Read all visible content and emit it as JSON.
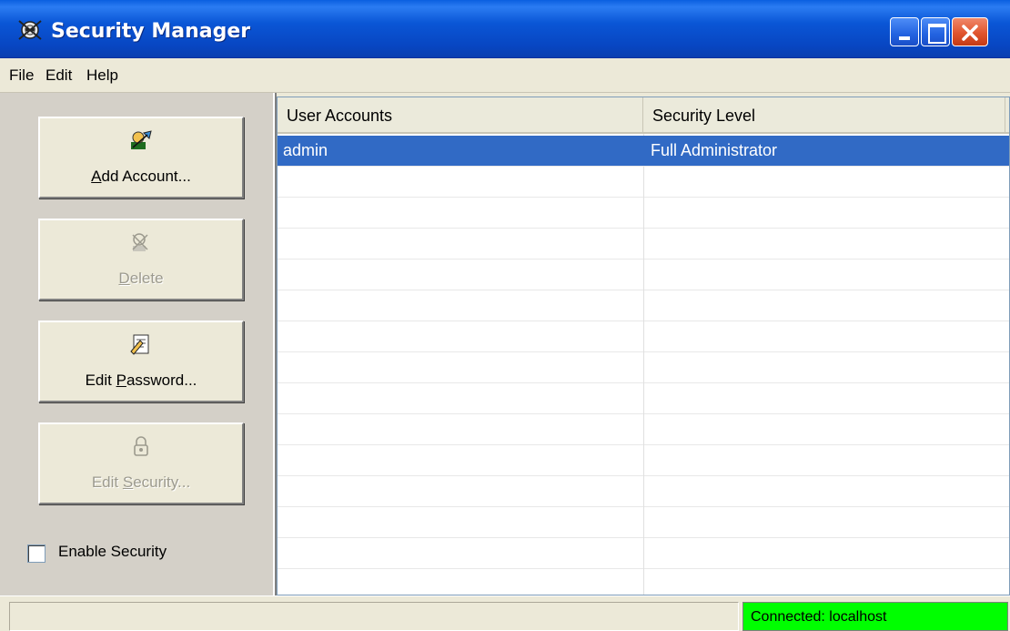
{
  "window": {
    "title": "Security Manager"
  },
  "menu": [
    {
      "label": "File"
    },
    {
      "label": "Edit"
    },
    {
      "label": "Help"
    }
  ],
  "commands": {
    "add_account": {
      "mnemonic": "A",
      "rest": "dd Account...",
      "enabled": true,
      "icon": "user-add-icon"
    },
    "delete": {
      "mnemonic": "D",
      "rest": "elete",
      "enabled": false,
      "icon": "user-delete-icon"
    },
    "edit_password": {
      "prefix": "Edit ",
      "mnemonic": "P",
      "rest": "assword...",
      "enabled": true,
      "icon": "password-icon"
    },
    "edit_security": {
      "prefix": "Edit ",
      "mnemonic": "S",
      "rest": "ecurity...",
      "enabled": false,
      "icon": "padlock-icon"
    }
  },
  "enable_security": {
    "label": "Enable Security",
    "checked": false
  },
  "list": {
    "columns": [
      "User Accounts",
      "Security Level"
    ],
    "rows": [
      {
        "user": "admin",
        "level": "Full Administrator",
        "selected": true
      }
    ]
  },
  "status": {
    "left": "",
    "right": "Connected: localhost",
    "right_color": "#00ff00"
  },
  "colors": {
    "selection": "#316ac5",
    "titlebar": "#0846c2"
  }
}
